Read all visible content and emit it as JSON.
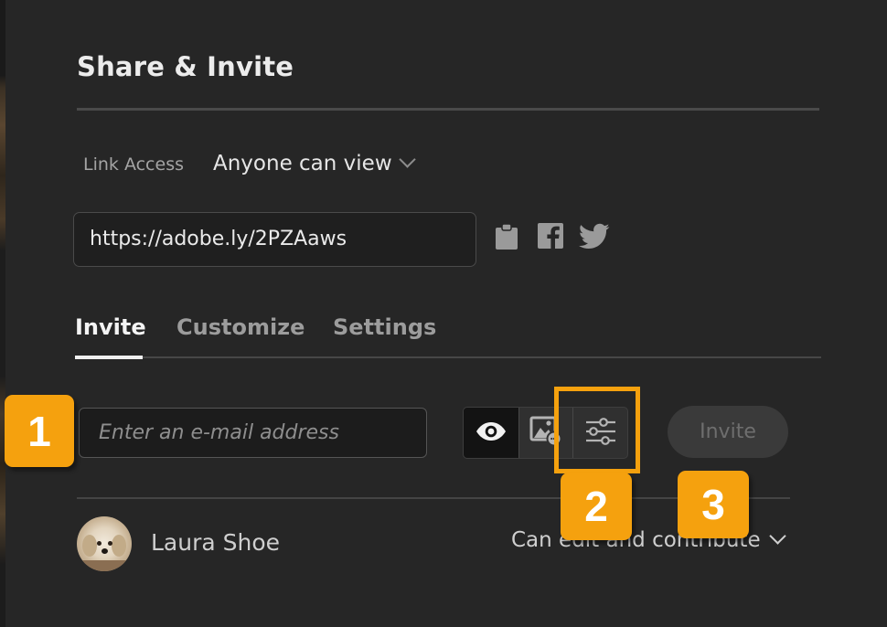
{
  "dialog": {
    "title": "Share & Invite"
  },
  "link_access": {
    "label": "Link Access",
    "value": "Anyone can view"
  },
  "share_url": {
    "value": "https://adobe.ly/2PZAaws"
  },
  "share_icons": [
    "clipboard-icon",
    "facebook-icon",
    "twitter-icon"
  ],
  "tabs": [
    {
      "label": "Invite",
      "active": true
    },
    {
      "label": "Customize",
      "active": false
    },
    {
      "label": "Settings",
      "active": false
    }
  ],
  "invite": {
    "email_placeholder": "Enter an e-mail address",
    "button_label": "Invite",
    "permission_buttons": [
      "eye-icon",
      "image-comment-icon",
      "sliders-icon"
    ]
  },
  "members": [
    {
      "name": "Laura Shoe",
      "permission": "Can edit and contribute"
    }
  ],
  "callouts": [
    "1",
    "2",
    "3"
  ],
  "colors": {
    "accent": "#f5a10e",
    "background": "#262626"
  }
}
